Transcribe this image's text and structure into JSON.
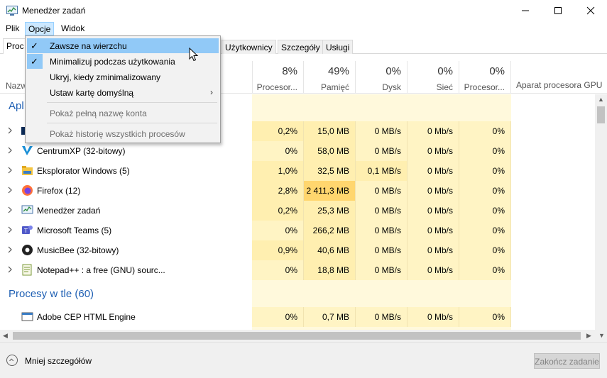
{
  "window": {
    "title": "Menedżer zadań"
  },
  "menubar": {
    "items": [
      {
        "label": "Plik"
      },
      {
        "label": "Opcje"
      },
      {
        "label": "Widok"
      }
    ]
  },
  "tabs": [
    {
      "label": "Proc"
    },
    {
      "label": "Użytkownicy"
    },
    {
      "label": "Szczegóły"
    },
    {
      "label": "Usługi"
    }
  ],
  "header": {
    "name_label": "Nazw",
    "columns": [
      {
        "pct": "8%",
        "label": "Procesor..."
      },
      {
        "pct": "49%",
        "label": "Pamięć"
      },
      {
        "pct": "0%",
        "label": "Dysk"
      },
      {
        "pct": "0%",
        "label": "Sieć"
      },
      {
        "pct": "0%",
        "label": "Procesor..."
      }
    ],
    "gpu_engine_label": "Aparat procesora GPU"
  },
  "groups": {
    "apps_title": "Apl",
    "background_title": "Procesy w tle (60)"
  },
  "processes": [
    {
      "name": "",
      "icon": "app-icon",
      "cpu": "0,2%",
      "mem": "15,0 MB",
      "disk": "0 MB/s",
      "net": "0 Mb/s",
      "gpu": "0%",
      "expandable": true
    },
    {
      "name": "CentrumXP (32-bitowy)",
      "icon": "centrumxp-icon",
      "cpu": "0%",
      "mem": "58,0 MB",
      "disk": "0 MB/s",
      "net": "0 Mb/s",
      "gpu": "0%",
      "expandable": true
    },
    {
      "name": "Eksplorator Windows (5)",
      "icon": "folder-icon",
      "cpu": "1,0%",
      "mem": "32,5 MB",
      "disk": "0,1 MB/s",
      "net": "0 Mb/s",
      "gpu": "0%",
      "expandable": true
    },
    {
      "name": "Firefox (12)",
      "icon": "firefox-icon",
      "cpu": "2,8%",
      "mem": "2 411,3 MB",
      "disk": "0 MB/s",
      "net": "0 Mb/s",
      "gpu": "0%",
      "expandable": true
    },
    {
      "name": "Menedżer zadań",
      "icon": "task-manager-icon",
      "cpu": "0,2%",
      "mem": "25,3 MB",
      "disk": "0 MB/s",
      "net": "0 Mb/s",
      "gpu": "0%",
      "expandable": true
    },
    {
      "name": "Microsoft Teams (5)",
      "icon": "teams-icon",
      "cpu": "0%",
      "mem": "266,2 MB",
      "disk": "0 MB/s",
      "net": "0 Mb/s",
      "gpu": "0%",
      "expandable": true
    },
    {
      "name": "MusicBee (32-bitowy)",
      "icon": "musicbee-icon",
      "cpu": "0,9%",
      "mem": "40,6 MB",
      "disk": "0 MB/s",
      "net": "0 Mb/s",
      "gpu": "0%",
      "expandable": true
    },
    {
      "name": "Notepad++ : a free (GNU) sourc...",
      "icon": "notepadpp-icon",
      "cpu": "0%",
      "mem": "18,8 MB",
      "disk": "0 MB/s",
      "net": "0 Mb/s",
      "gpu": "0%",
      "expandable": true
    }
  ],
  "background_processes": [
    {
      "name": "Adobe CEP HTML Engine",
      "icon": "window-icon",
      "cpu": "0%",
      "mem": "0,7 MB",
      "disk": "0 MB/s",
      "net": "0 Mb/s",
      "gpu": "0%"
    }
  ],
  "options_menu": {
    "items": [
      {
        "label": "Zawsze na wierzchu",
        "checked": true
      },
      {
        "label": "Minimalizuj podczas użytkowania",
        "checked": true
      },
      {
        "label": "Ukryj, kiedy zminimalizowany",
        "checked": false
      },
      {
        "label": "Ustaw kartę domyślną",
        "checked": false,
        "submenu": true
      },
      {
        "label": "Pokaż pełną nazwę konta",
        "disabled": true
      },
      {
        "label": "Pokaż historię wszystkich procesów",
        "disabled": true
      }
    ]
  },
  "footer": {
    "less_details": "Mniej szczegółów",
    "end_task": "Zakończ zadanie"
  }
}
